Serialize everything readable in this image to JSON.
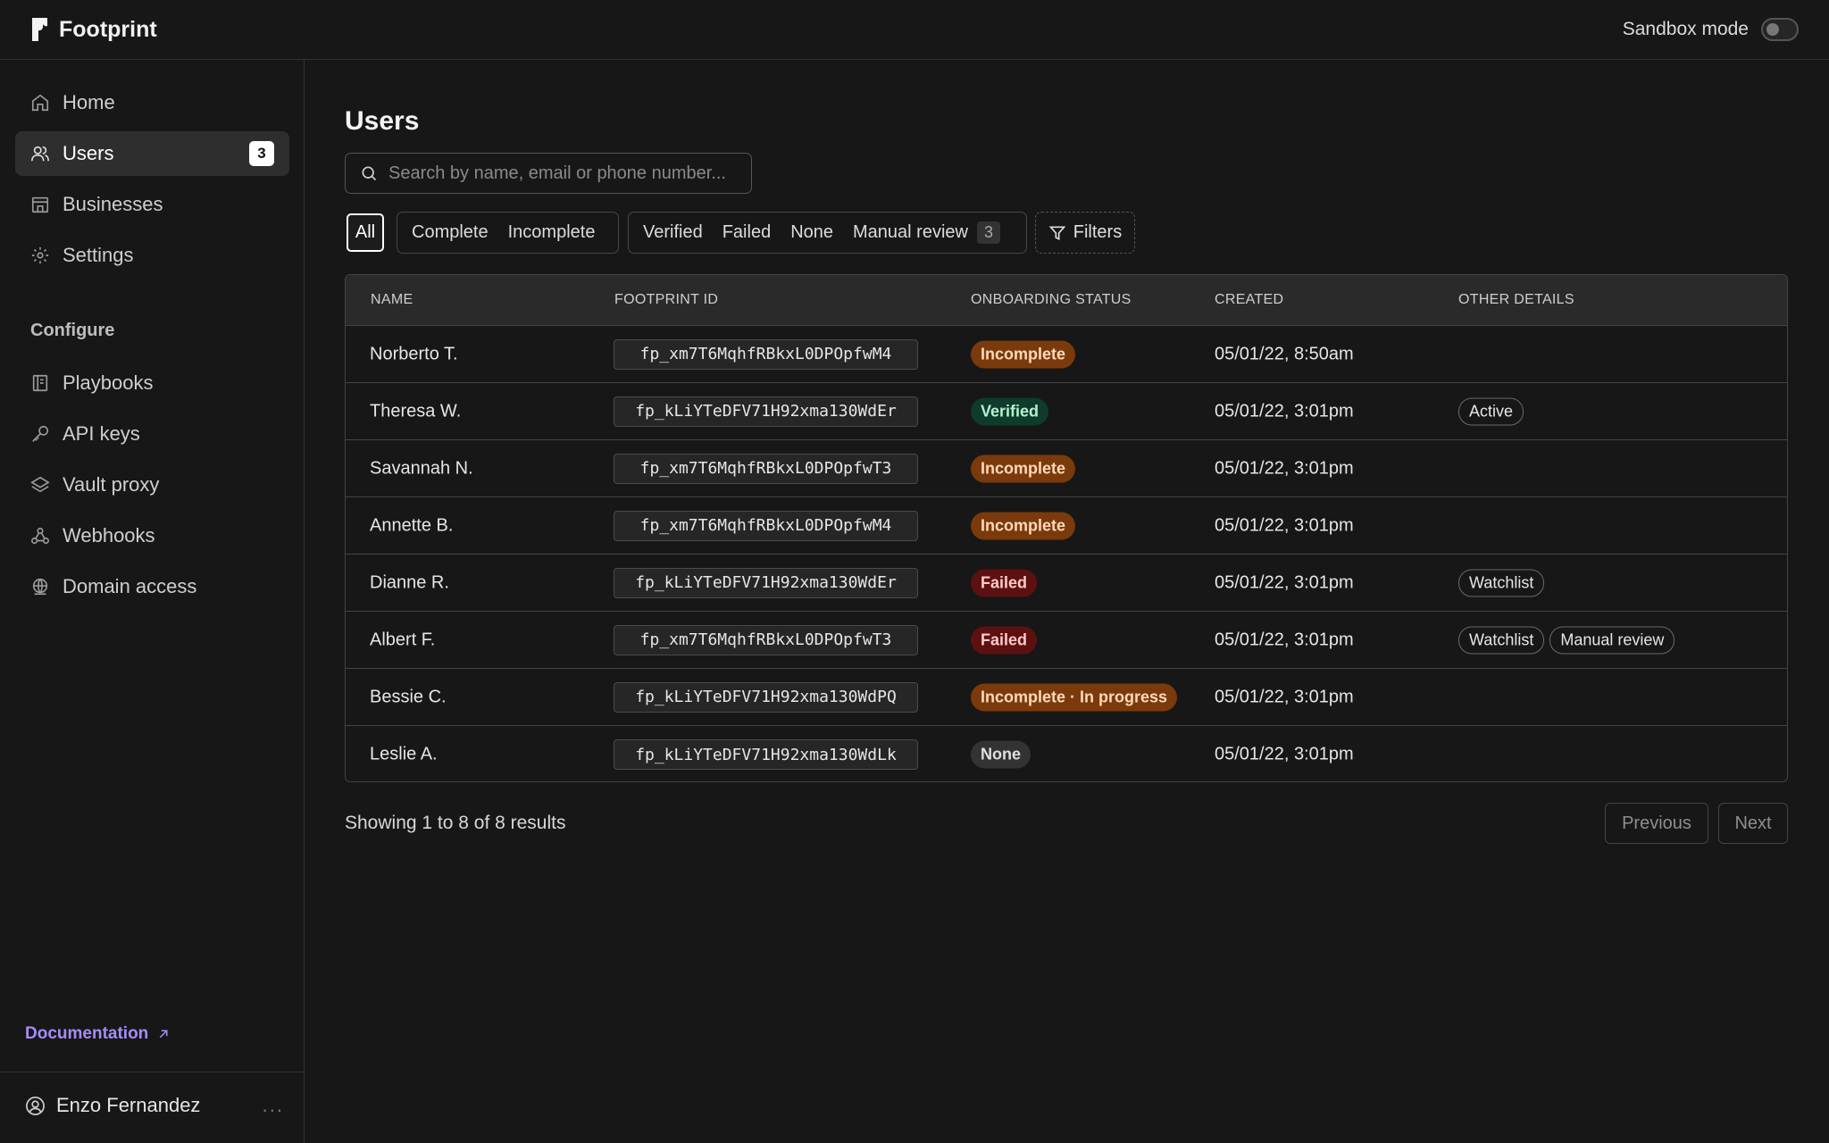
{
  "app": {
    "name": "Footprint",
    "sandbox_label": "Sandbox mode"
  },
  "sidebar": {
    "items": [
      {
        "label": "Home",
        "icon": "home-icon"
      },
      {
        "label": "Users",
        "icon": "users-icon",
        "badge": "3"
      },
      {
        "label": "Businesses",
        "icon": "store-icon"
      },
      {
        "label": "Settings",
        "icon": "gear-icon"
      }
    ],
    "section_label": "Configure",
    "config_items": [
      {
        "label": "Playbooks",
        "icon": "book-icon"
      },
      {
        "label": "API keys",
        "icon": "key-icon"
      },
      {
        "label": "Vault proxy",
        "icon": "layers-icon"
      },
      {
        "label": "Webhooks",
        "icon": "webhook-icon"
      },
      {
        "label": "Domain access",
        "icon": "globe-icon"
      }
    ],
    "documentation": "Documentation",
    "user_name": "Enzo Fernandez",
    "more": "..."
  },
  "page": {
    "title": "Users",
    "search_placeholder": "Search by name, email or phone number..."
  },
  "filters": {
    "all": "All",
    "complete": "Complete",
    "incomplete": "Incomplete",
    "verified": "Verified",
    "failed": "Failed",
    "none": "None",
    "manual_review": "Manual review",
    "manual_review_count": "3",
    "filters_button": "Filters"
  },
  "table": {
    "headers": {
      "name": "NAME",
      "footprint_id": "FOOTPRINT ID",
      "status": "ONBOARDING STATUS",
      "created": "CREATED",
      "details": "OTHER DETAILS"
    },
    "rows": [
      {
        "name": "Norberto T.",
        "id": "fp_xm7T6MqhfRBkxL0DPOpfwM4",
        "status": "Incomplete",
        "status_kind": "incomplete",
        "created": "05/01/22, 8:50am",
        "tags": [
          "",
          ""
        ]
      },
      {
        "name": "Theresa W.",
        "id": "fp_kLiYTeDFV71H92xma130WdEr",
        "status": "Verified",
        "status_kind": "verified",
        "created": "05/01/22, 3:01pm",
        "tags": [
          "Active",
          ""
        ]
      },
      {
        "name": "Savannah N.",
        "id": "fp_xm7T6MqhfRBkxL0DPOpfwT3",
        "status": "Incomplete",
        "status_kind": "incomplete",
        "created": "05/01/22, 3:01pm",
        "tags": [
          "",
          ""
        ]
      },
      {
        "name": "Annette B.",
        "id": "fp_xm7T6MqhfRBkxL0DPOpfwM4",
        "status": "Incomplete",
        "status_kind": "incomplete",
        "created": "05/01/22, 3:01pm",
        "tags": [
          "",
          ""
        ]
      },
      {
        "name": "Dianne R.",
        "id": "fp_kLiYTeDFV71H92xma130WdEr",
        "status": "Failed",
        "status_kind": "failed",
        "created": "05/01/22, 3:01pm",
        "tags": [
          "Watchlist",
          ""
        ]
      },
      {
        "name": "Albert F.",
        "id": "fp_xm7T6MqhfRBkxL0DPOpfwT3",
        "status": "Failed",
        "status_kind": "failed",
        "created": "05/01/22, 3:01pm",
        "tags": [
          "Watchlist",
          "Manual review"
        ]
      },
      {
        "name": "Bessie C.",
        "id": "fp_kLiYTeDFV71H92xma130WdPQ",
        "status": "Incomplete · In progress",
        "status_kind": "incomplete",
        "created": "05/01/22, 3:01pm",
        "tags": [
          "",
          ""
        ]
      },
      {
        "name": "Leslie A.",
        "id": "fp_kLiYTeDFV71H92xma130WdLk",
        "status": "None",
        "status_kind": "none",
        "created": "05/01/22, 3:01pm",
        "tags": [
          "",
          ""
        ]
      }
    ]
  },
  "pagination": {
    "summary": "Showing 1 to 8 of 8 results",
    "previous": "Previous",
    "next": "Next"
  },
  "colors": {
    "incomplete_bg": "#7a3a0c",
    "incomplete_fg": "#ffd9b8",
    "verified_bg": "#0e3b2a",
    "verified_fg": "#b6f0d3",
    "failed_bg": "#5c1010",
    "failed_fg": "#ffc9c9",
    "none_bg": "#333333",
    "none_fg": "#e0e0e0",
    "accent": "#a78bfa"
  }
}
